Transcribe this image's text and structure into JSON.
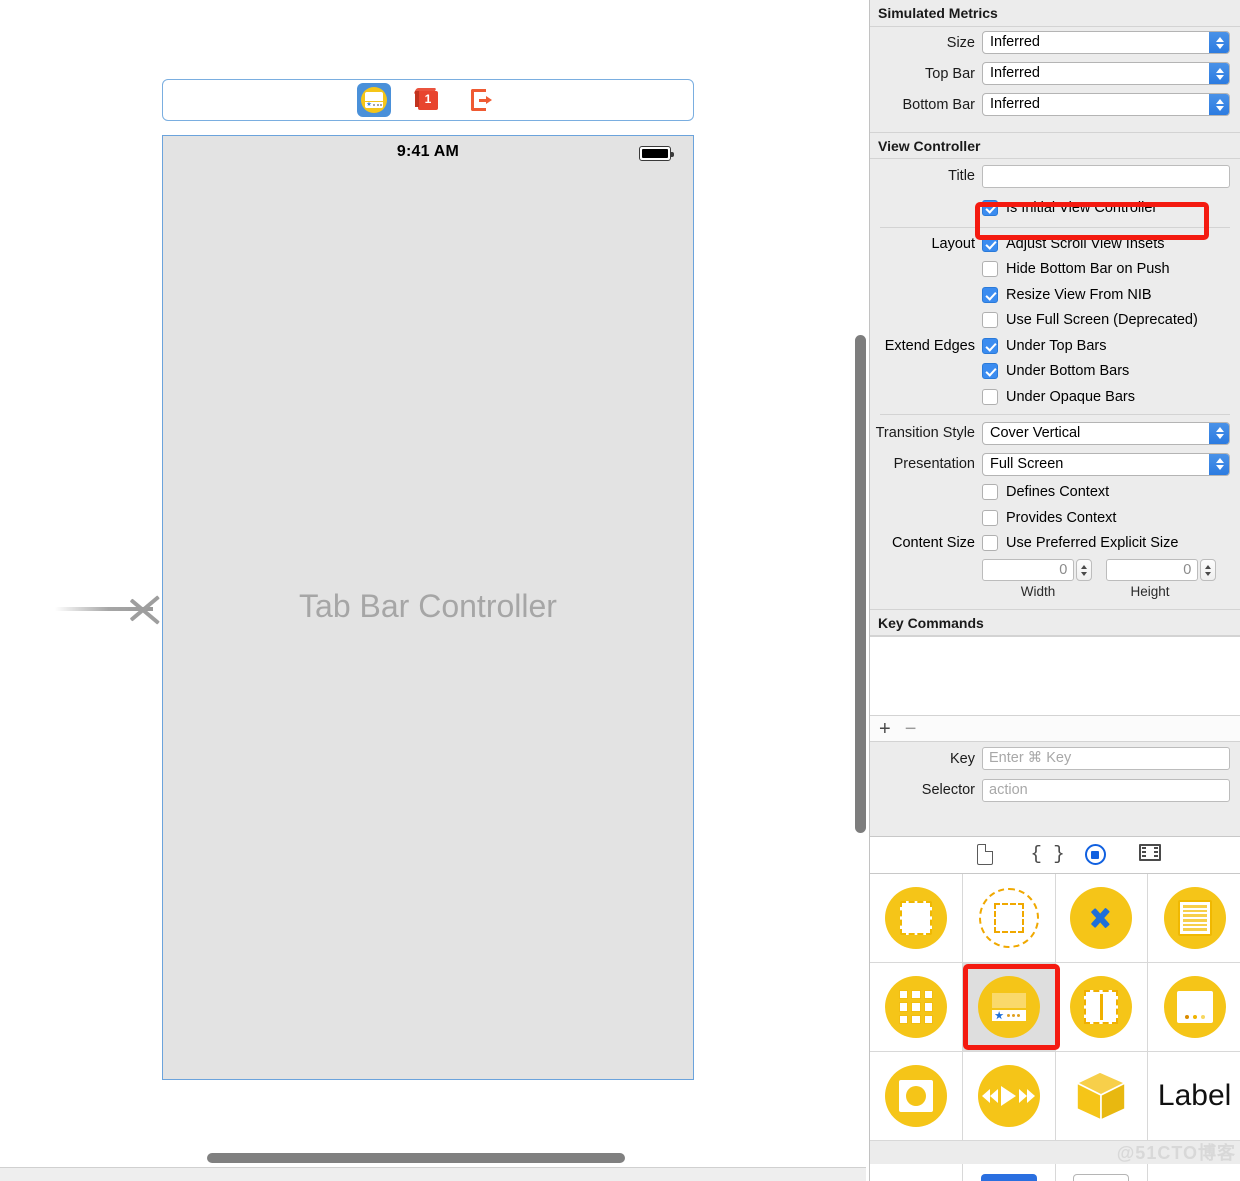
{
  "canvas": {
    "scene_toolbar": {
      "icons": [
        {
          "name": "tab-bar-controller-icon",
          "selected": true
        },
        {
          "name": "first-responder-cube-icon",
          "badge": "1"
        },
        {
          "name": "exit-segue-icon"
        }
      ]
    },
    "phone": {
      "status_bar": {
        "time": "9:41 AM",
        "battery": "battery-full-icon"
      },
      "title": "Tab Bar Controller"
    },
    "entry_arrow": "initial-view-controller-arrow"
  },
  "inspector": {
    "simulated_metrics": {
      "header": "Simulated Metrics",
      "rows": [
        {
          "label": "Size",
          "value": "Inferred"
        },
        {
          "label": "Top Bar",
          "value": "Inferred"
        },
        {
          "label": "Bottom Bar",
          "value": "Inferred"
        }
      ]
    },
    "view_controller": {
      "header": "View Controller",
      "title_label": "Title",
      "title_value": "",
      "is_initial": {
        "label": "Is Initial View Controller",
        "checked": true
      },
      "layout_label": "Layout",
      "layout_items": [
        {
          "label": "Adjust Scroll View Insets",
          "checked": true
        },
        {
          "label": "Hide Bottom Bar on Push",
          "checked": false
        },
        {
          "label": "Resize View From NIB",
          "checked": true
        },
        {
          "label": "Use Full Screen (Deprecated)",
          "checked": false
        }
      ],
      "extend_edges_label": "Extend Edges",
      "extend_items": [
        {
          "label": "Under Top Bars",
          "checked": true
        },
        {
          "label": "Under Bottom Bars",
          "checked": true
        },
        {
          "label": "Under Opaque Bars",
          "checked": false
        }
      ],
      "transition_style": {
        "label": "Transition Style",
        "value": "Cover Vertical"
      },
      "presentation": {
        "label": "Presentation",
        "value": "Full Screen"
      },
      "context_items": [
        {
          "label": "Defines Context",
          "checked": false
        },
        {
          "label": "Provides Context",
          "checked": false
        }
      ],
      "content_size_label": "Content Size",
      "content_size_item": {
        "label": "Use Preferred Explicit Size",
        "checked": false
      },
      "width_value": "0",
      "height_value": "0",
      "width_caption": "Width",
      "height_caption": "Height"
    },
    "key_commands": {
      "header": "Key Commands",
      "add_button": "+",
      "remove_button": "−",
      "key_label": "Key",
      "key_placeholder": "Enter ⌘ Key",
      "selector_label": "Selector",
      "selector_placeholder": "action"
    }
  },
  "library": {
    "toolbar": [
      {
        "name": "file-template-icon",
        "selected": false
      },
      {
        "name": "code-snippet-icon",
        "selected": false
      },
      {
        "name": "object-library-icon",
        "selected": true
      },
      {
        "name": "media-library-icon",
        "selected": false
      }
    ],
    "items": [
      {
        "name": "view-controller-object",
        "selected": false
      },
      {
        "name": "storyboard-reference-object",
        "selected": false
      },
      {
        "name": "navigation-controller-object",
        "selected": false
      },
      {
        "name": "table-view-controller-object",
        "selected": false
      },
      {
        "name": "collection-view-controller-object",
        "selected": false
      },
      {
        "name": "tab-bar-controller-object",
        "selected": true
      },
      {
        "name": "split-view-controller-object",
        "selected": false
      },
      {
        "name": "page-view-controller-object",
        "selected": false
      },
      {
        "name": "image-view-controller-object",
        "selected": false
      },
      {
        "name": "av-player-view-controller-object",
        "selected": false
      },
      {
        "name": "glkit-view-controller-object",
        "selected": false
      },
      {
        "name": "label-object",
        "label": "Label",
        "selected": false
      }
    ]
  },
  "watermark": "@51CTO博客",
  "colors": {
    "accent_blue": "#3b8cf0",
    "highlight_red": "#f41a10",
    "library_yellow": "#f5c518",
    "canvas_gray": "#e3e3e3"
  }
}
